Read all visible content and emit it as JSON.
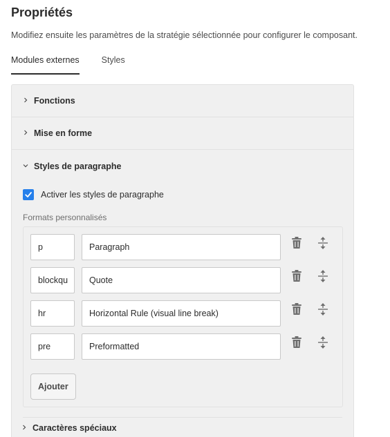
{
  "page": {
    "title": "Propriétés",
    "description": "Modifiez ensuite les paramètres de la stratégie sélectionnée pour configurer le composant."
  },
  "tabs": [
    {
      "label": "Modules externes",
      "selected": true
    },
    {
      "label": "Styles",
      "selected": false
    }
  ],
  "accordion": {
    "fonctions": {
      "label": "Fonctions",
      "expanded": false
    },
    "mise_en_forme": {
      "label": "Mise en forme",
      "expanded": false
    },
    "styles_paragraphe": {
      "label": "Styles de paragraphe",
      "expanded": true,
      "checkbox": {
        "label": "Activer les styles de paragraphe",
        "checked": true
      },
      "formats_label": "Formats personnalisés",
      "formats": [
        {
          "tag": "p",
          "description": "Paragraph"
        },
        {
          "tag": "blockqu",
          "description": "Quote"
        },
        {
          "tag": "hr",
          "description": "Horizontal Rule (visual line break)"
        },
        {
          "tag": "pre",
          "description": "Preformatted"
        }
      ],
      "add_button": "Ajouter"
    },
    "caracteres_speciaux": {
      "label": "Caractères spéciaux",
      "expanded": false
    }
  },
  "icons": {
    "collapsed": "chevron-right-icon",
    "expanded": "chevron-down-icon",
    "delete": "trash-icon",
    "reorder": "move-handle-icon",
    "check": "checkmark-icon"
  },
  "colors": {
    "accent": "#2680eb",
    "panel_bg": "#f0f0f0",
    "text": "#2c2c2c",
    "icon": "#6e6e6e"
  }
}
